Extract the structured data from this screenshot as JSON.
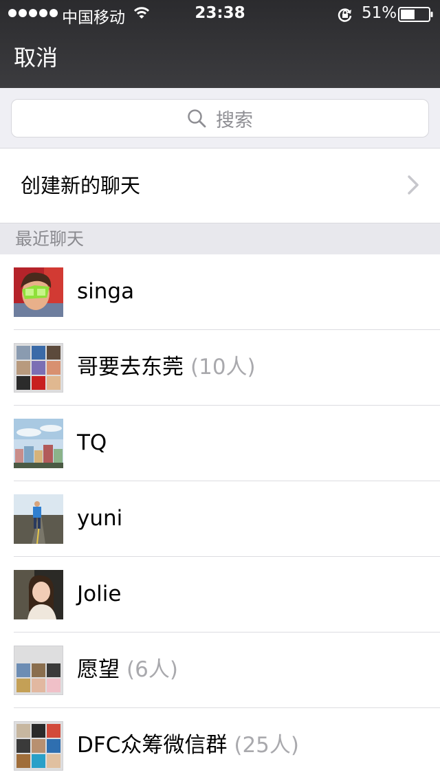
{
  "status_bar": {
    "carrier": "中国移动",
    "time": "23:38",
    "battery_percent": "51%",
    "battery_level": 0.51
  },
  "nav": {
    "cancel_label": "取消"
  },
  "search": {
    "placeholder": "搜索"
  },
  "create_chat": {
    "label": "创建新的聊天"
  },
  "section": {
    "title": "最近聊天"
  },
  "chats": [
    {
      "name": "singa",
      "count": ""
    },
    {
      "name": "哥要去东莞",
      "count": "(10人)"
    },
    {
      "name": "TQ",
      "count": ""
    },
    {
      "name": "yuni",
      "count": ""
    },
    {
      "name": "Jolie",
      "count": ""
    },
    {
      "name": "愿望",
      "count": "(6人)"
    },
    {
      "name": "DFC众筹微信群",
      "count": "(25人)"
    }
  ]
}
